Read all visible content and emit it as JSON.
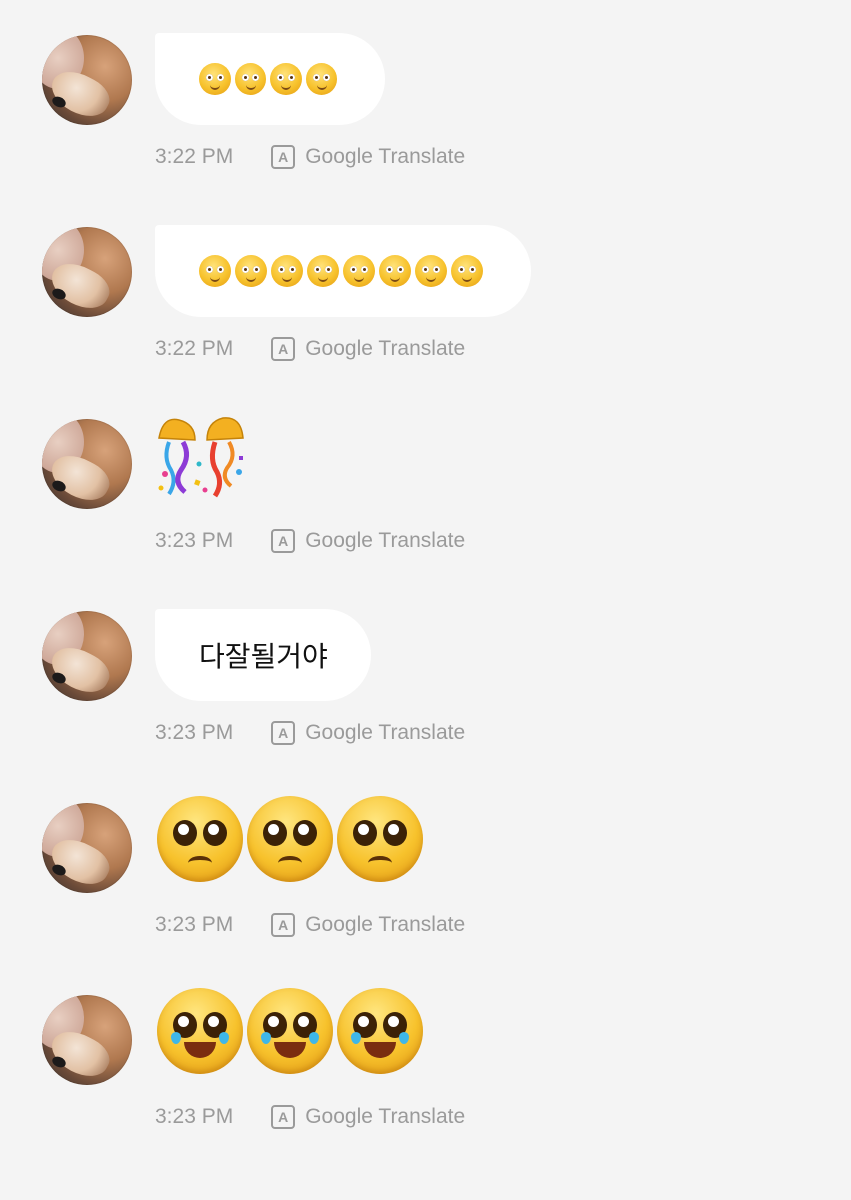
{
  "messages": [
    {
      "type": "bubble-emoji",
      "emoji_name": "smiling-face-with-tear",
      "count": 4,
      "time": "3:22 PM",
      "translate_label": "Google Translate"
    },
    {
      "type": "bubble-emoji",
      "emoji_name": "smiling-face-with-tear",
      "count": 8,
      "time": "3:22 PM",
      "translate_label": "Google Translate"
    },
    {
      "type": "confetti",
      "emoji_name": "confetti-ball",
      "time": "3:23 PM",
      "translate_label": "Google Translate"
    },
    {
      "type": "text",
      "text": "다잘될거야",
      "time": "3:23 PM",
      "translate_label": "Google Translate"
    },
    {
      "type": "big-emoji",
      "emoji_name": "pleading-face",
      "count": 3,
      "time": "3:23 PM",
      "translate_label": "Google Translate"
    },
    {
      "type": "big-emoji",
      "emoji_name": "face-holding-back-tears",
      "count": 3,
      "time": "3:23 PM",
      "translate_label": "Google Translate"
    }
  ],
  "colors": {
    "background": "#f4f4f4",
    "bubble": "#ffffff",
    "meta_text": "#9a9a9a"
  },
  "icons": {
    "translate": "translate-icon",
    "avatar": "avatar-dog-photo"
  }
}
